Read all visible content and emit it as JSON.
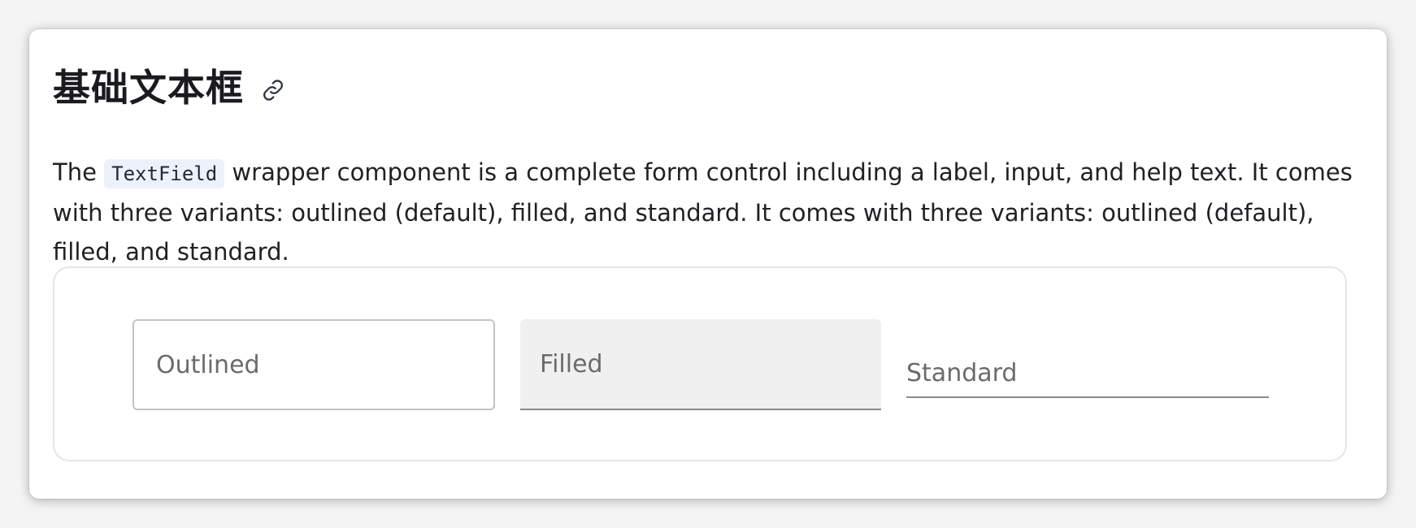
{
  "section": {
    "title": "基础文本框",
    "link_icon": "link-icon",
    "description": {
      "before_code": "The ",
      "code": "TextField",
      "after_code": " wrapper component is a complete form control including a label, input, and help text. It comes with three variants: outlined (default), filled, and standard. It comes with three variants: outlined (default), filled, and standard."
    }
  },
  "demo": {
    "fields": {
      "outlined_label": "Outlined",
      "filled_label": "Filled",
      "standard_label": "Standard"
    }
  },
  "colors": {
    "title_text": "#1b1b1f",
    "code_background": "#edf2fa",
    "filled_background": "#f0f0f0",
    "outline_border": "#c4c4c4",
    "label_text": "#6b6b6b"
  }
}
